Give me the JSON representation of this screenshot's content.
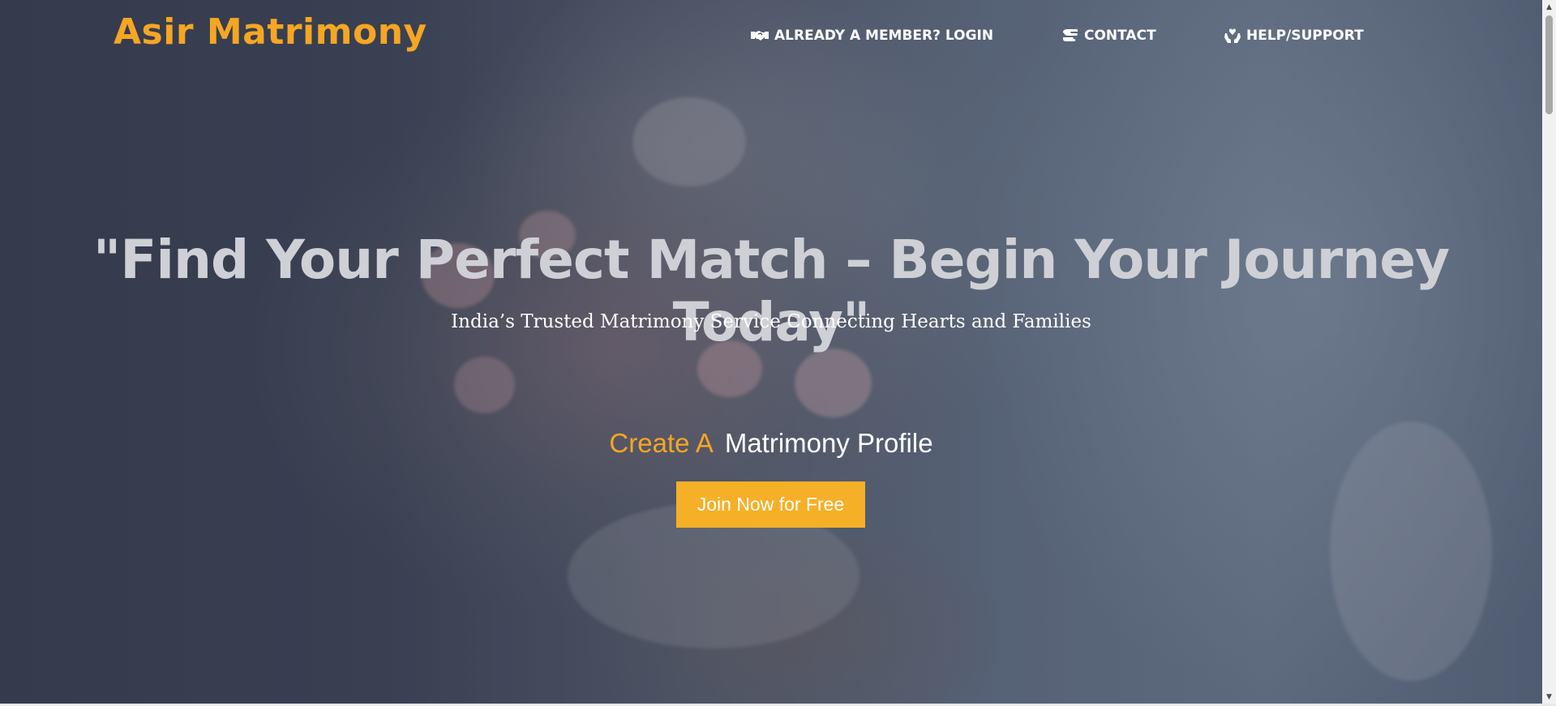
{
  "brand": {
    "name": "Asir Matrimony",
    "color": "#f5a623"
  },
  "nav": {
    "items": [
      {
        "label": "ALREADY A MEMBER? LOGIN",
        "icon": "handshake-icon"
      },
      {
        "label": "CONTACT",
        "icon": "contact-hand-icon"
      },
      {
        "label": "HELP/SUPPORT",
        "icon": "hands-heart-icon"
      }
    ]
  },
  "hero": {
    "headline": "\"Find Your Perfect Match – Begin Your Journey Today\"",
    "tagline": "India’s Trusted Matrimony Service Connecting Hearts and Families",
    "cta_accent": "Create A",
    "cta_rest": "Matrimony Profile",
    "button_label": "Join Now for Free",
    "button_color": "#f5b027"
  },
  "scrollbar": {
    "up": "▲",
    "down": "▼"
  }
}
